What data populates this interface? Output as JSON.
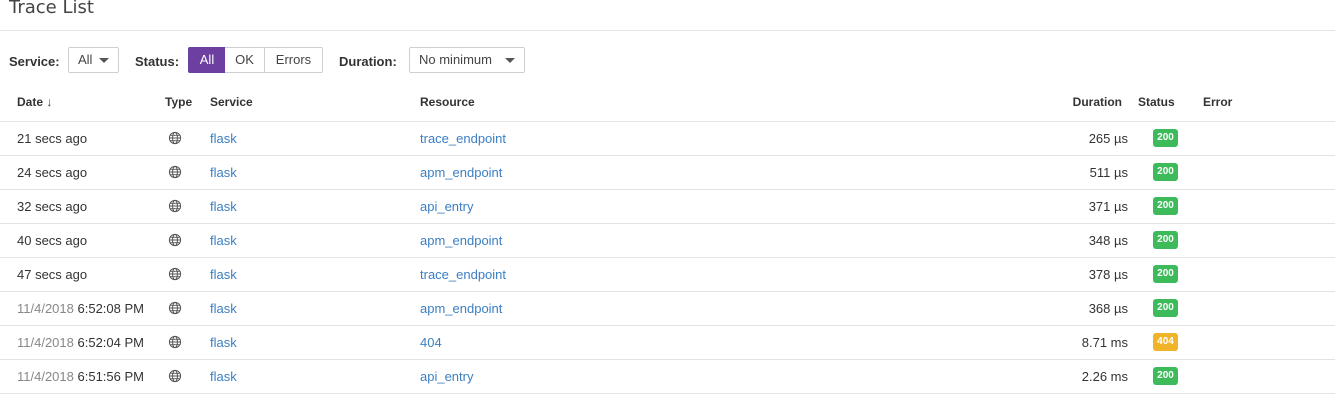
{
  "header": {
    "title": "Trace List"
  },
  "filters": {
    "service_label": "Service:",
    "service_value": "All",
    "status_label": "Status:",
    "status_options": [
      "All",
      "OK",
      "Errors"
    ],
    "status_selected": "All",
    "duration_label": "Duration:",
    "duration_value": "No minimum"
  },
  "table": {
    "columns": {
      "date": "Date ↓",
      "type": "Type",
      "service": "Service",
      "resource": "Resource",
      "duration": "Duration",
      "status": "Status",
      "error": "Error"
    },
    "rows": [
      {
        "date_part": "",
        "time": "21 secs ago",
        "type_icon": "globe-icon",
        "service": "flask",
        "resource": "trace_endpoint",
        "duration": "265 µs",
        "status": "200",
        "error": ""
      },
      {
        "date_part": "",
        "time": "24 secs ago",
        "type_icon": "globe-icon",
        "service": "flask",
        "resource": "apm_endpoint",
        "duration": "511 µs",
        "status": "200",
        "error": ""
      },
      {
        "date_part": "",
        "time": "32 secs ago",
        "type_icon": "globe-icon",
        "service": "flask",
        "resource": "api_entry",
        "duration": "371 µs",
        "status": "200",
        "error": ""
      },
      {
        "date_part": "",
        "time": "40 secs ago",
        "type_icon": "globe-icon",
        "service": "flask",
        "resource": "apm_endpoint",
        "duration": "348 µs",
        "status": "200",
        "error": ""
      },
      {
        "date_part": "",
        "time": "47 secs ago",
        "type_icon": "globe-icon",
        "service": "flask",
        "resource": "trace_endpoint",
        "duration": "378 µs",
        "status": "200",
        "error": ""
      },
      {
        "date_part": "11/4/2018",
        "time": "6:52:08 PM",
        "type_icon": "globe-icon",
        "service": "flask",
        "resource": "apm_endpoint",
        "duration": "368 µs",
        "status": "200",
        "error": ""
      },
      {
        "date_part": "11/4/2018",
        "time": "6:52:04 PM",
        "type_icon": "globe-icon",
        "service": "flask",
        "resource": "404",
        "duration": "8.71 ms",
        "status": "404",
        "error": ""
      },
      {
        "date_part": "11/4/2018",
        "time": "6:51:56 PM",
        "type_icon": "globe-icon",
        "service": "flask",
        "resource": "api_entry",
        "duration": "2.26 ms",
        "status": "200",
        "error": ""
      }
    ]
  },
  "colors": {
    "accent": "#6d3fa0",
    "link": "#3b7fc4",
    "status_ok": "#3dbb5a",
    "status_warn": "#f0b429"
  }
}
